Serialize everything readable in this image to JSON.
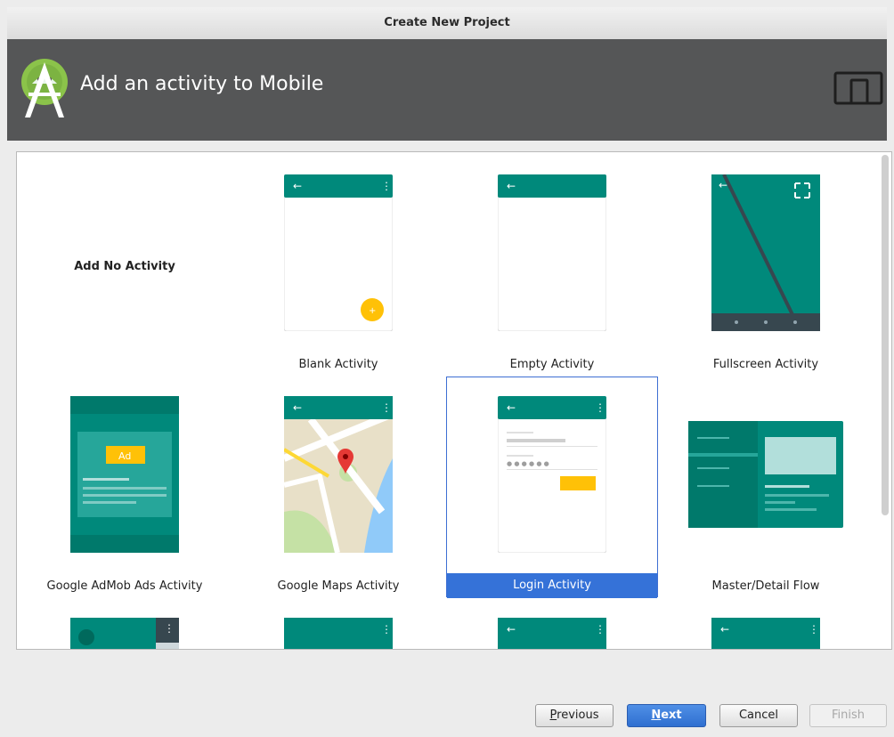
{
  "window": {
    "title": "Create New Project"
  },
  "header": {
    "title": "Add an activity to Mobile"
  },
  "templates": [
    {
      "label": "Add No Activity"
    },
    {
      "label": "Blank Activity"
    },
    {
      "label": "Empty Activity"
    },
    {
      "label": "Fullscreen Activity"
    },
    {
      "label": "Google AdMob Ads Activity"
    },
    {
      "label": "Google Maps Activity"
    },
    {
      "label": "Login Activity",
      "selected": true
    },
    {
      "label": "Master/Detail Flow"
    }
  ],
  "thumb_text": {
    "ad": "Ad"
  },
  "buttons": {
    "previous_mnemonic": "P",
    "previous_rest": "revious",
    "next_mnemonic": "N",
    "next_rest": "ext",
    "cancel": "Cancel",
    "finish": "Finish"
  },
  "colors": {
    "teal": "#00897b",
    "teal_dark": "#00695c",
    "accent_yellow": "#ffc107",
    "selection_blue": "#3572d8",
    "header_bg": "#555657"
  }
}
